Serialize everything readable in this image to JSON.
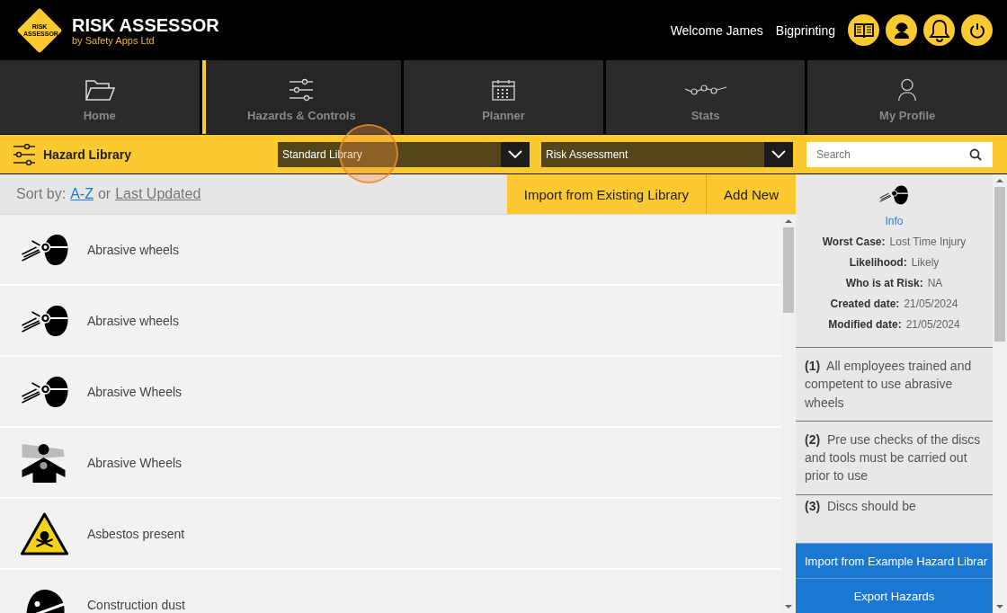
{
  "header": {
    "logo_text": "RISK ASSESSOR",
    "title": "RISK ASSESSOR",
    "subtitle": "by Safety Apps Ltd",
    "welcome": "Welcome James",
    "company": "Bigprinting"
  },
  "nav_tabs": [
    {
      "label": "Home",
      "kind": "folder",
      "selected": false
    },
    {
      "label": "Hazards & Controls",
      "kind": "sliders",
      "selected": true
    },
    {
      "label": "Planner",
      "kind": "calendar",
      "selected": false
    },
    {
      "label": "Stats",
      "kind": "stats",
      "selected": false
    },
    {
      "label": "My Profile",
      "kind": "person",
      "selected": false
    }
  ],
  "toolbar": {
    "title": "Hazard Library",
    "library_select": "Standard Library",
    "type_select": "Risk Assessment",
    "search": {
      "placeholder": "Search"
    }
  },
  "sort": {
    "label": "Sort by:",
    "joiner": "or",
    "options": [
      {
        "label": "A-Z",
        "selected": true
      },
      {
        "label": "Last Updated",
        "selected": false
      }
    ]
  },
  "actions": [
    "Import from Existing Library",
    "Add New"
  ],
  "hazards": [
    {
      "name": "Abrasive wheels",
      "kind": "goggles"
    },
    {
      "name": "Abrasive wheels",
      "kind": "goggles"
    },
    {
      "name": "Abrasive Wheels",
      "kind": "goggles"
    },
    {
      "name": "Abrasive Wheels",
      "kind": "dust"
    },
    {
      "name": "Asbestos present",
      "kind": "toxic"
    },
    {
      "name": "Construction dust",
      "kind": "mask"
    }
  ],
  "info": {
    "heading": "Info",
    "fields": [
      {
        "label": "Worst Case:",
        "value": "Lost Time Injury"
      },
      {
        "label": "Likelihood:",
        "value": "Likely"
      },
      {
        "label": "Who is at Risk:",
        "value": "NA"
      },
      {
        "label": "Created date:",
        "value": "21/05/2024"
      },
      {
        "label": "Modified date:",
        "value": "21/05/2024"
      }
    ]
  },
  "controls": [
    {
      "number": "(1)",
      "text": "All employees trained and competent to use abrasive wheels"
    },
    {
      "number": "(2)",
      "text": "Pre use checks of the discs and tools must be carried out prior to use"
    },
    {
      "number": "(3)",
      "text": "Discs should be"
    }
  ],
  "bottom_buttons": [
    "Import from Example Hazard Librar",
    "Export Hazards"
  ]
}
